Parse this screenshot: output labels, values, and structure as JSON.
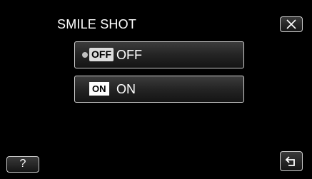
{
  "header": {
    "title": "SMILE SHOT",
    "close_icon": "close-icon"
  },
  "options": [
    {
      "badge": "OFF",
      "label": "OFF",
      "selected": true
    },
    {
      "badge": "ON",
      "label": "ON",
      "selected": false
    }
  ],
  "footer": {
    "help_label": "?",
    "back_icon": "return-arrow-icon"
  },
  "colors": {
    "background": "#000000",
    "text": "#ffffff",
    "button_border": "#d0d0d0"
  }
}
